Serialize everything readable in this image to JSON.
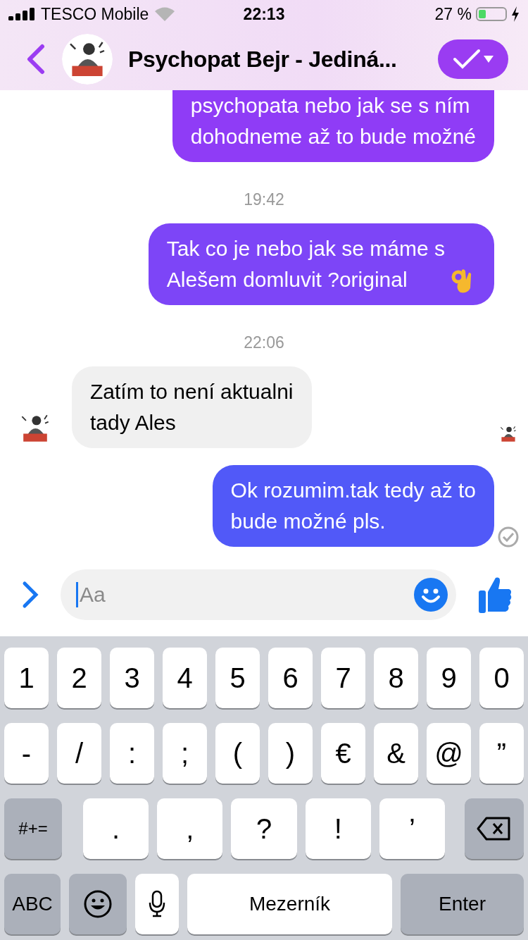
{
  "status_bar": {
    "carrier": "TESCO Mobile",
    "time": "22:13",
    "battery_text": "27 %"
  },
  "header": {
    "title": "Psychopat Bejr - Jediná..."
  },
  "messages": [
    {
      "kind": "out",
      "color": "#8f3cf6",
      "text": "psychopata nebo jak se s ním\ndohodneme až to bude možné",
      "cut_top": true
    },
    {
      "kind": "time",
      "text": "19:42"
    },
    {
      "kind": "out",
      "color": "#7d45f7",
      "text": "Tak co je nebo jak se máme s\nAlešem domluvit ?original",
      "cut_top": false,
      "emoji": true
    },
    {
      "kind": "time",
      "text": "22:06"
    },
    {
      "kind": "in",
      "text": "Zatím to není aktualni\ntady Ales",
      "seen": true
    },
    {
      "kind": "out",
      "color": "#5159f8",
      "text": "Ok rozumim.tak tedy až to\nbude možné pls.",
      "cut_top": false,
      "delivered": true
    }
  ],
  "composer": {
    "placeholder": "Aa"
  },
  "keyboard": {
    "key_rows": [
      {
        "keys": [
          {
            "kind": "char",
            "label": "1"
          },
          {
            "kind": "char",
            "label": "2"
          },
          {
            "kind": "char",
            "label": "3"
          },
          {
            "kind": "char",
            "label": "4"
          },
          {
            "kind": "char",
            "label": "5"
          },
          {
            "kind": "char",
            "label": "6"
          },
          {
            "kind": "char",
            "label": "7"
          },
          {
            "kind": "char",
            "label": "8"
          },
          {
            "kind": "char",
            "label": "9"
          },
          {
            "kind": "char",
            "label": "0"
          }
        ]
      },
      {
        "keys": [
          {
            "kind": "char",
            "label": "-"
          },
          {
            "kind": "char",
            "label": "/"
          },
          {
            "kind": "char",
            "label": ":"
          },
          {
            "kind": "char",
            "label": ";"
          },
          {
            "kind": "char",
            "label": "("
          },
          {
            "kind": "char",
            "label": ")"
          },
          {
            "kind": "char",
            "label": "€"
          },
          {
            "kind": "char",
            "label": "&"
          },
          {
            "kind": "char",
            "label": "@"
          },
          {
            "kind": "char",
            "label": "”"
          }
        ]
      },
      {
        "keys": [
          {
            "kind": "shift",
            "label": "#+="
          },
          {
            "kind": "char",
            "label": "."
          },
          {
            "kind": "char",
            "label": ","
          },
          {
            "kind": "char",
            "label": "?"
          },
          {
            "kind": "char",
            "label": "!"
          },
          {
            "kind": "char",
            "label": "’"
          },
          {
            "kind": "delete"
          }
        ]
      },
      {
        "keys": [
          {
            "kind": "abc",
            "label": "ABC"
          },
          {
            "kind": "emoji"
          },
          {
            "kind": "mic"
          },
          {
            "kind": "space",
            "label": "Mezerník"
          },
          {
            "kind": "return",
            "label": "Enter"
          }
        ]
      }
    ]
  }
}
